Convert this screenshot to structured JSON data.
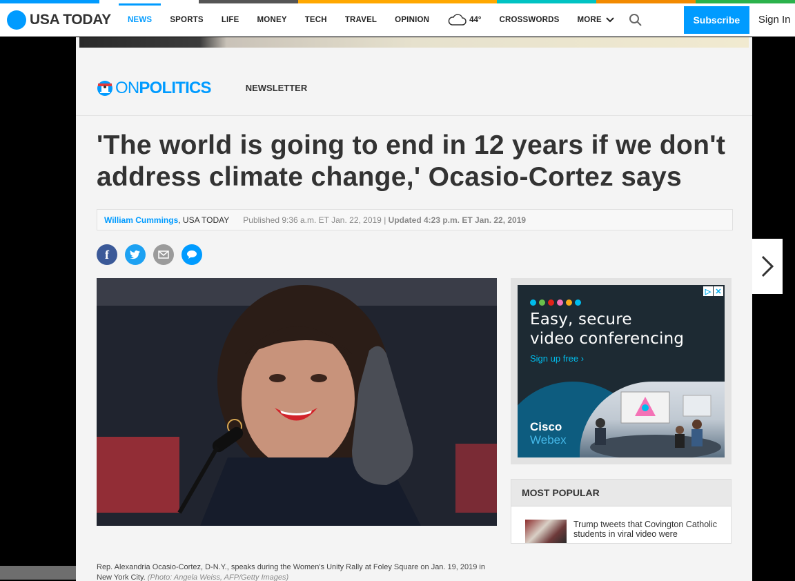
{
  "nav": {
    "logo": "USA TODAY",
    "items": [
      "NEWS",
      "SPORTS",
      "LIFE",
      "MONEY",
      "TECH",
      "TRAVEL",
      "OPINION"
    ],
    "weather_temp": "44°",
    "items2": [
      "CROSSWORDS",
      "MORE"
    ],
    "subscribe": "Subscribe",
    "signin": "Sign In",
    "colors": [
      "#009bff",
      "#ffffff",
      "#ff4747",
      "#f5a623",
      "#333333",
      "#00b3b3",
      "#f59e00",
      "#2bb24c"
    ]
  },
  "section": {
    "on": "ON",
    "politics": "POLITICS",
    "newsletter": "NEWSLETTER"
  },
  "article": {
    "headline": "'The world is going to end in 12 years if we don't address climate change,' Ocasio-Cortez says",
    "author": "William Cummings",
    "outlet": ", USA TODAY",
    "published": "Published 9:36 a.m. ET Jan. 22, 2019 | ",
    "updated": "Updated 4:23 p.m. ET Jan. 22, 2019",
    "caption": "Rep. Alexandria Ocasio-Cortez, D-N.Y., speaks during the Women's Unity Rally at Foley Square on Jan. 19, 2019 in New York City.",
    "credit": "(Photo: Angela Weiss, AFP/Getty Images)"
  },
  "share": {
    "facebook_icon": "f",
    "twitter_icon": "twitter-bird",
    "email_icon": "envelope",
    "comment_icon": "speech-bubble"
  },
  "ad": {
    "headline_line1": "Easy, secure",
    "headline_line2": "video conferencing",
    "cta": "Sign up free  ›",
    "brand": "Cisco",
    "product": "Webex",
    "adchoices": "▷",
    "close": "✕"
  },
  "popular": {
    "title": "MOST POPULAR",
    "item1": "Trump tweets that Covington Catholic students in viral video were"
  },
  "next_arrow": "›"
}
